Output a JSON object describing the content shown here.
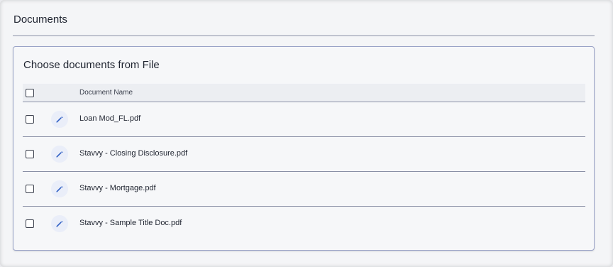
{
  "header": {
    "title": "Documents"
  },
  "panel": {
    "title": "Choose documents from File",
    "columns": {
      "name": "Document Name"
    },
    "rows": [
      {
        "name": "Loan Mod_FL.pdf",
        "icon": "pencil-icon"
      },
      {
        "name": "Stavvy - Closing Disclosure.pdf",
        "icon": "pencil-icon"
      },
      {
        "name": "Stavvy - Mortgage.pdf",
        "icon": "pencil-icon"
      },
      {
        "name": "Stavvy - Sample Title Doc.pdf",
        "icon": "pencil-icon"
      }
    ]
  },
  "colors": {
    "accent": "#2f5fc4",
    "border": "#8a90a6"
  }
}
